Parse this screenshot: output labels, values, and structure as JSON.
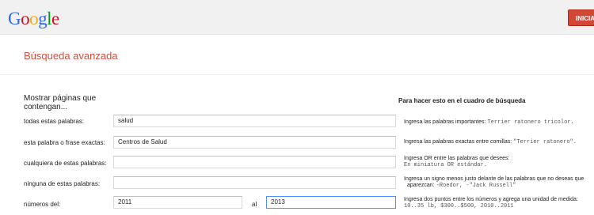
{
  "header": {
    "logo": [
      "G",
      "o",
      "o",
      "g",
      "l",
      "e"
    ],
    "logo_colors": [
      "#3369e8",
      "#d50f25",
      "#eeb211",
      "#3369e8",
      "#009925",
      "#d50f25"
    ],
    "signin_label": "INICIAR"
  },
  "page_title": "Búsqueda avanzada",
  "section": {
    "heading": "Mostrar páginas que contengan...",
    "hint_heading": "Para hacer esto en el cuadro de búsqueda"
  },
  "rows": [
    {
      "label": "todas estas palabras:",
      "value": "salud",
      "hint_text": "Ingresa las palabras importantes: ",
      "hint_example": "Terrier ratonero tricolor."
    },
    {
      "label": "esta palabra o frase exactas:",
      "value": "Centros de Salud",
      "hint_text": "Ingresa las palabras exactas entre comillas: ",
      "hint_example": "\"Terrier ratonero\"."
    },
    {
      "label": "cualquiera de estas palabras:",
      "value": "",
      "hint_text": "Ingresa OR entre las palabras que desees:",
      "hint_example": "En miniatura OR estándar."
    },
    {
      "label": "ninguna de estas palabras:",
      "value": "",
      "hint_text": "Ingresa un signo menos justo delante de las palabras que no deseas que",
      "hint_line2": "aparezcan: ",
      "hint_example": "-Roedor, -\"Jack Russell\""
    },
    {
      "label": "números del:",
      "value_from": "2011",
      "separator": "al",
      "value_to": "2013",
      "hint_text": "Ingresa dos puntos entre los números y agrega una unidad de medida:",
      "hint_example": "10..35 lb, $300..$500, 2010..2011"
    }
  ]
}
